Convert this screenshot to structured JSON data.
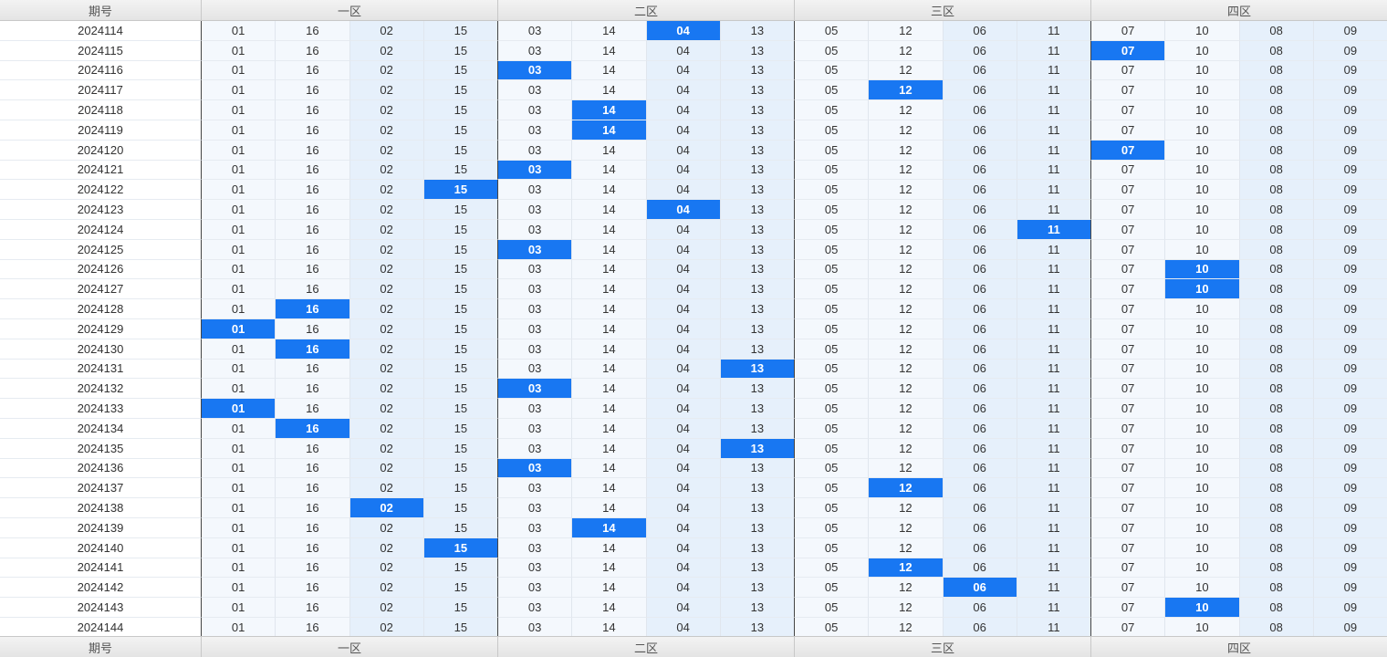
{
  "header": {
    "period_label": "期号",
    "zones": [
      {
        "label": "一区",
        "numbers": [
          "01",
          "16",
          "02",
          "15"
        ]
      },
      {
        "label": "二区",
        "numbers": [
          "03",
          "14",
          "04",
          "13"
        ]
      },
      {
        "label": "三区",
        "numbers": [
          "05",
          "12",
          "06",
          "11"
        ]
      },
      {
        "label": "四区",
        "numbers": [
          "07",
          "10",
          "08",
          "09"
        ]
      }
    ]
  },
  "colors": {
    "highlight": "#1877f2",
    "column_light": "#f4f8fd",
    "column_dark": "#e6f0fb",
    "header_bg": "#e8e8e8"
  },
  "rows": [
    {
      "period": "2024114",
      "hit": [
        1,
        2
      ]
    },
    {
      "period": "2024115",
      "hit": [
        3,
        0
      ]
    },
    {
      "period": "2024116",
      "hit": [
        1,
        0
      ]
    },
    {
      "period": "2024117",
      "hit": [
        2,
        1
      ]
    },
    {
      "period": "2024118",
      "hit": [
        1,
        1
      ]
    },
    {
      "period": "2024119",
      "hit": [
        1,
        1
      ]
    },
    {
      "period": "2024120",
      "hit": [
        3,
        0
      ]
    },
    {
      "period": "2024121",
      "hit": [
        1,
        0
      ]
    },
    {
      "period": "2024122",
      "hit": [
        0,
        3
      ]
    },
    {
      "period": "2024123",
      "hit": [
        1,
        2
      ]
    },
    {
      "period": "2024124",
      "hit": [
        2,
        3
      ]
    },
    {
      "period": "2024125",
      "hit": [
        1,
        0
      ]
    },
    {
      "period": "2024126",
      "hit": [
        3,
        1
      ]
    },
    {
      "period": "2024127",
      "hit": [
        3,
        1
      ]
    },
    {
      "period": "2024128",
      "hit": [
        0,
        1
      ]
    },
    {
      "period": "2024129",
      "hit": [
        0,
        0
      ]
    },
    {
      "period": "2024130",
      "hit": [
        0,
        1
      ]
    },
    {
      "period": "2024131",
      "hit": [
        1,
        3
      ]
    },
    {
      "period": "2024132",
      "hit": [
        1,
        0
      ]
    },
    {
      "period": "2024133",
      "hit": [
        0,
        0
      ]
    },
    {
      "period": "2024134",
      "hit": [
        0,
        1
      ]
    },
    {
      "period": "2024135",
      "hit": [
        1,
        3
      ]
    },
    {
      "period": "2024136",
      "hit": [
        1,
        0
      ]
    },
    {
      "period": "2024137",
      "hit": [
        2,
        1
      ]
    },
    {
      "period": "2024138",
      "hit": [
        0,
        2
      ]
    },
    {
      "period": "2024139",
      "hit": [
        1,
        1
      ]
    },
    {
      "period": "2024140",
      "hit": [
        0,
        3
      ]
    },
    {
      "period": "2024141",
      "hit": [
        2,
        1
      ]
    },
    {
      "period": "2024142",
      "hit": [
        2,
        2
      ]
    },
    {
      "period": "2024143",
      "hit": [
        3,
        1
      ]
    },
    {
      "period": "2024144",
      "hit": null
    }
  ]
}
